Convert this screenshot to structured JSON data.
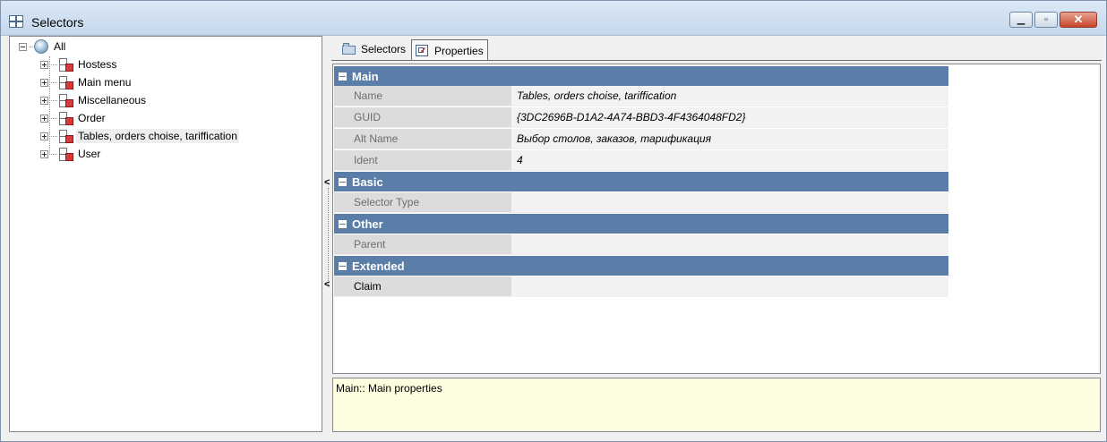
{
  "window": {
    "title": "Selectors",
    "minimize_glyph": "▁",
    "maximize_glyph": "▫",
    "close_glyph": "✕"
  },
  "tree": {
    "root": {
      "label": "All",
      "icon": "globe-icon"
    },
    "items": [
      {
        "label": "Hostess"
      },
      {
        "label": "Main menu"
      },
      {
        "label": "Miscellaneous"
      },
      {
        "label": "Order"
      },
      {
        "label": "Tables, orders choise, tariffication"
      },
      {
        "label": "User"
      }
    ],
    "selected_index": 4
  },
  "splitter": {
    "collapse_glyph": "<"
  },
  "tabs": [
    {
      "label": "Selectors",
      "icon": "folder-icon"
    },
    {
      "label": "Properties",
      "icon": "properties-icon"
    }
  ],
  "active_tab": "Properties",
  "property_grid": {
    "categories": [
      {
        "label": "Main",
        "rows": [
          {
            "name": "Name",
            "value": "Tables, orders choise, tariffication"
          },
          {
            "name": "GUID",
            "value": "{3DC2696B-D1A2-4A74-BBD3-4F4364048FD2}"
          },
          {
            "name": "Alt Name",
            "value": "Выбор столов, заказов, тарификация"
          },
          {
            "name": "Ident",
            "value": "4"
          }
        ]
      },
      {
        "label": "Basic",
        "rows": [
          {
            "name": "Selector Type",
            "value": ""
          }
        ]
      },
      {
        "label": "Other",
        "rows": [
          {
            "name": "Parent",
            "value": ""
          }
        ]
      },
      {
        "label": "Extended",
        "rows": [
          {
            "name": "Claim",
            "value": ""
          }
        ]
      }
    ]
  },
  "description": "Main:: Main properties",
  "colors": {
    "category_header": "#5a7ea8",
    "description_bg": "#fdfde0",
    "close_button": "#c7452b"
  }
}
